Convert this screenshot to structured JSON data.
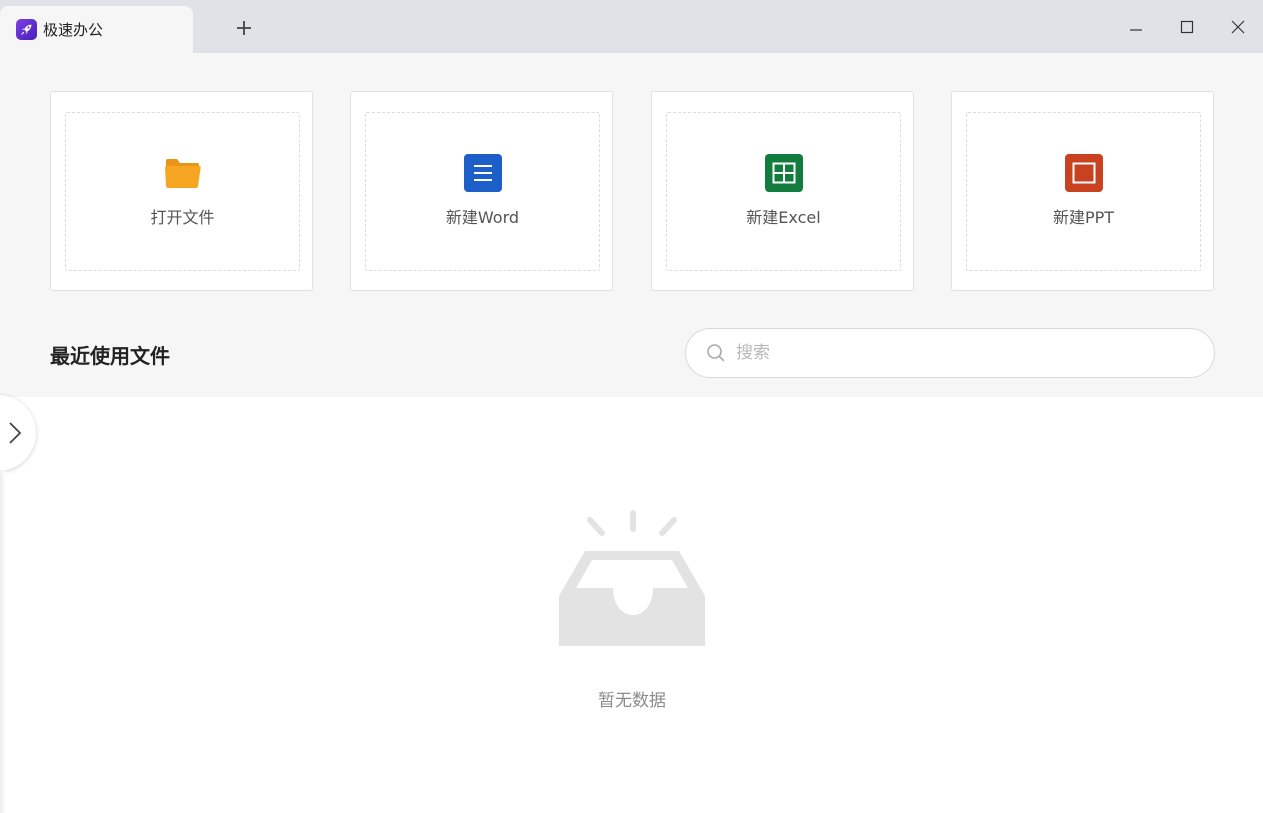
{
  "titlebar": {
    "tab_title": "极速办公",
    "app_logo_icon": "rocket-icon",
    "new_tab_icon": "plus-icon",
    "minimize_icon": "minimize-icon",
    "maximize_icon": "maximize-icon",
    "close_icon": "close-icon"
  },
  "actions": [
    {
      "label": "打开文件",
      "icon": "folder-icon",
      "color": "#f5a623"
    },
    {
      "label": "新建Word",
      "icon": "word-doc-icon",
      "color": "#1c5fc9"
    },
    {
      "label": "新建Excel",
      "icon": "excel-sheet-icon",
      "color": "#127c3f"
    },
    {
      "label": "新建PPT",
      "icon": "ppt-slide-icon",
      "color": "#c84120"
    }
  ],
  "recent": {
    "title": "最近使用文件",
    "search_placeholder": "搜索",
    "search_value": ""
  },
  "sidebar_toggle_icon": "chevron-right-icon",
  "empty_state": {
    "icon": "empty-inbox-icon",
    "text": "暂无数据"
  }
}
